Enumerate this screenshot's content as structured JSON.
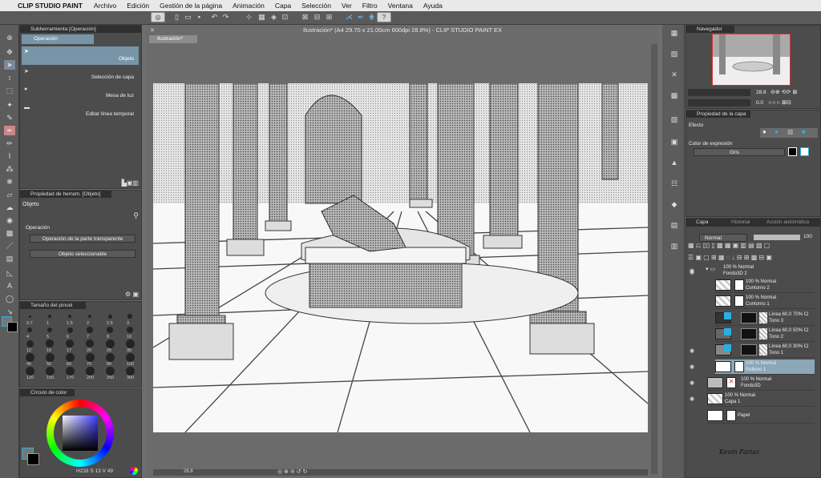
{
  "menubar": {
    "apple": "",
    "app": "CLIP STUDIO PAINT",
    "items": [
      "Archivo",
      "Edición",
      "Gestión de la página",
      "Animación",
      "Capa",
      "Selección",
      "Ver",
      "Filtro",
      "Ventana",
      "Ayuda"
    ]
  },
  "document": {
    "title": "Ilustración* (A4 29.70 x 21.00cm 600dpi 28.8%) - CLIP STUDIO PAINT EX",
    "tab": "Ilustración*",
    "zoom": "28.8"
  },
  "subtool": {
    "header": "Subherramienta [Operación]",
    "tab": "Operación",
    "items": [
      "Objeto",
      "Selección de capa",
      "Mesa de luz",
      "Editar línea temporal"
    ]
  },
  "toolprops": {
    "header": "Propiedad de herram. [Objeto]",
    "title": "Objeto",
    "section": "Operación",
    "dropdown1": "Operación de la parte transparente",
    "dropdown2": "Objeto seleccionable"
  },
  "brushsize": {
    "header": "Tamaño del pincel",
    "sizes": [
      "0.7",
      "1",
      "1.5",
      "2",
      "2.5",
      "3",
      "4",
      "5",
      "6",
      "7",
      "8",
      "10",
      "12",
      "15",
      "17",
      "20",
      "25",
      "30",
      "40",
      "50",
      "60",
      "70",
      "80",
      "100",
      "120",
      "150",
      "170",
      "200",
      "250",
      "300"
    ]
  },
  "colorwheel": {
    "header": "Círculo de color",
    "values": [
      "233",
      "13",
      "49"
    ]
  },
  "navigator": {
    "tab": "Navegador",
    "zoom": "28.8",
    "rotation": "0.0"
  },
  "layerprops": {
    "tab": "Propiedad de la capa",
    "effect": "Efecto",
    "expression_color": "Color de expresión",
    "color_value": "Gris"
  },
  "layerpanel": {
    "tabs": [
      "Capa",
      "Historial",
      "Acción automática"
    ],
    "blend": "Normal",
    "opacity": "100",
    "layers": [
      {
        "line1": "100 % Normal",
        "line2": "Fondo3D 2"
      },
      {
        "line1": "100 % Normal",
        "line2": "Contorno 2"
      },
      {
        "line1": "100 % Normal",
        "line2": "Contorno 1"
      },
      {
        "line1": "Línea 60.0 70% Ci",
        "line2": "Tono 3"
      },
      {
        "line1": "Línea 60.0 50% Ci",
        "line2": "Tono 2"
      },
      {
        "line1": "Línea 60.0 30% Ci",
        "line2": "Tono 1"
      },
      {
        "line1": "100 % Normal",
        "line2": "Relleno 1"
      },
      {
        "line1": "100 % Normal",
        "line2": "Fondo3D"
      },
      {
        "line1": "100 % Normal",
        "line2": "Capa 1"
      },
      {
        "line1": "",
        "line2": "Papel"
      }
    ]
  },
  "signature": "Kevin Farias",
  "colors": {
    "accent": "#2aa8d8",
    "selected": "#8ba7b8",
    "panel": "#4c4c4c"
  }
}
